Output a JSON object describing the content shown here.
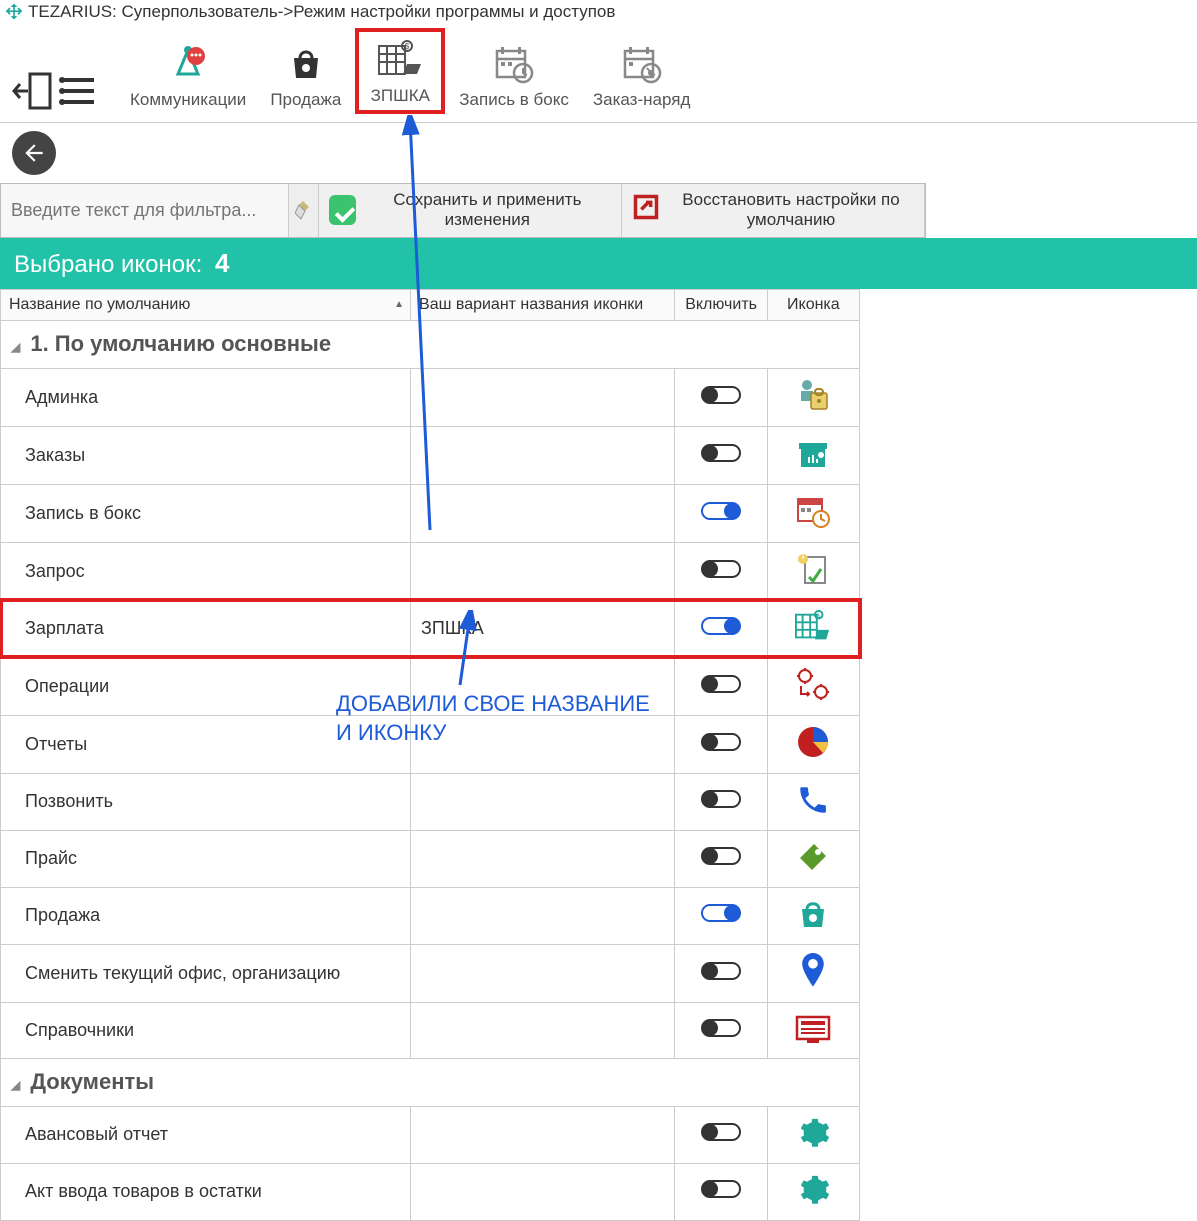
{
  "window": {
    "title": "TEZARIUS: Суперпользователь->Режим настройки программы и доступов"
  },
  "ribbon": {
    "items": [
      {
        "label": "Коммуникации",
        "selected": false
      },
      {
        "label": "Продажа",
        "selected": false
      },
      {
        "label": "ЗПШКА",
        "selected": true
      },
      {
        "label": "Запись в бокс",
        "selected": false
      },
      {
        "label": "Заказ-наряд",
        "selected": false
      }
    ]
  },
  "actions": {
    "filter_placeholder": "Введите текст для фильтра...",
    "save": "Сохранить и применить изменения",
    "restore": "Восстановить настройки по умолчанию"
  },
  "status": {
    "label": "Выбрано иконок:",
    "count": "4"
  },
  "columns": {
    "name": "Название по умолчанию",
    "custom": "Ваш вариант названия иконки",
    "enable": "Включить",
    "icon": "Иконка"
  },
  "groups": [
    {
      "title": "1. По умолчанию основные",
      "rows": [
        {
          "name": "Админка",
          "custom": "",
          "enabled": false,
          "icon": "admin",
          "color": "#d69a2a"
        },
        {
          "name": "Заказы",
          "custom": "",
          "enabled": false,
          "icon": "orders",
          "color": "#1fa89a"
        },
        {
          "name": "Запись в бокс",
          "custom": "",
          "enabled": true,
          "icon": "calendar",
          "color": "#888"
        },
        {
          "name": "Запрос",
          "custom": "",
          "enabled": false,
          "icon": "request",
          "color": "#d6a040"
        },
        {
          "name": "Зарплата",
          "custom": "ЗПШКА",
          "enabled": true,
          "icon": "salary",
          "color": "#1fa89a",
          "highlight": true
        },
        {
          "name": "Операции",
          "custom": "",
          "enabled": false,
          "icon": "ops",
          "color": "#c02020"
        },
        {
          "name": "Отчеты",
          "custom": "",
          "enabled": false,
          "icon": "reports",
          "color": "#c02020"
        },
        {
          "name": "Позвонить",
          "custom": "",
          "enabled": false,
          "icon": "phone",
          "color": "#1e5bd6"
        },
        {
          "name": "Прайс",
          "custom": "",
          "enabled": false,
          "icon": "price",
          "color": "#5a9a2a"
        },
        {
          "name": "Продажа",
          "custom": "",
          "enabled": true,
          "icon": "sale",
          "color": "#1fa89a"
        },
        {
          "name": "Сменить текущий офис, организацию",
          "custom": "",
          "enabled": false,
          "icon": "location",
          "color": "#1e5bd6"
        },
        {
          "name": "Справочники",
          "custom": "",
          "enabled": false,
          "icon": "ref",
          "color": "#c02020"
        }
      ]
    },
    {
      "title": "Документы",
      "rows": [
        {
          "name": "Авансовый отчет",
          "custom": "",
          "enabled": false,
          "icon": "gear",
          "color": "#1fa89a"
        },
        {
          "name": "Акт ввода товаров в остатки",
          "custom": "",
          "enabled": false,
          "icon": "gear",
          "color": "#1fa89a"
        }
      ]
    }
  ],
  "annotation": {
    "text": "ДОБАВИЛИ СВОЕ НАЗВАНИЕ И ИКОНКУ"
  }
}
